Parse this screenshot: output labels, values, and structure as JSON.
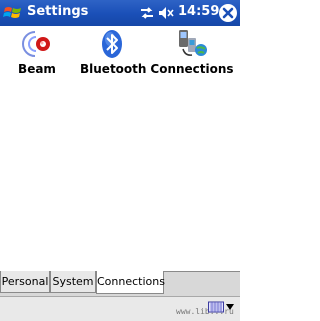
{
  "titlebar": {
    "title": "Settings",
    "time": "14:59",
    "icons": [
      "windows-start-icon",
      "connectivity-icon",
      "volume-icon",
      "close-icon"
    ],
    "color": "#1c52b8"
  },
  "tiles": [
    {
      "label": "Beam",
      "icon": "beam-icon"
    },
    {
      "label": "Bluetooth",
      "icon": "bluetooth-icon"
    },
    {
      "label": "Connections",
      "icon": "connections-icon"
    }
  ],
  "tabs": [
    {
      "label": "Personal",
      "selected": false
    },
    {
      "label": "System",
      "selected": false
    },
    {
      "label": "Connections",
      "selected": true
    }
  ],
  "menubar": {
    "watermark": "www.lib...ru",
    "icons": [
      "keyboard-icon",
      "input-menu-arrow-icon"
    ]
  }
}
